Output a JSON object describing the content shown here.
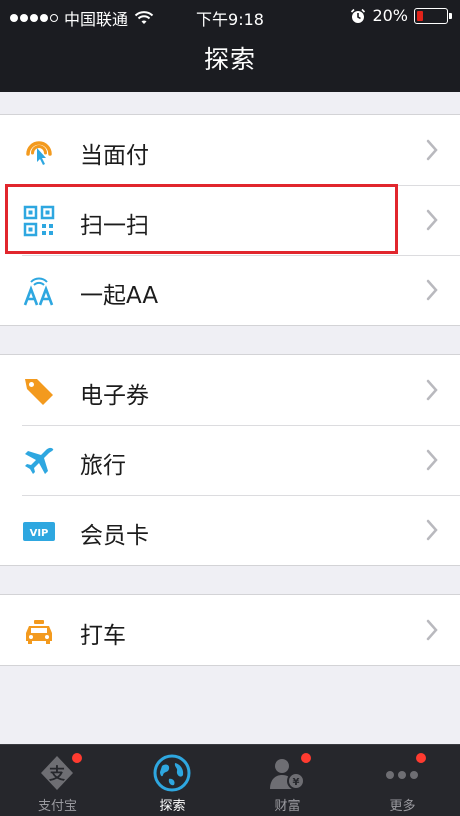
{
  "status_bar": {
    "carrier": "中国联通",
    "time": "下午9:18",
    "battery": "20%",
    "battery_level": 0.2
  },
  "nav": {
    "title": "探索"
  },
  "groups": [
    {
      "items": [
        {
          "label": "当面付",
          "icon": "face-to-face-pay-icon"
        },
        {
          "label": "扫一扫",
          "icon": "qr-scan-icon"
        },
        {
          "label": "一起AA",
          "icon": "split-bill-aa-icon"
        }
      ]
    },
    {
      "items": [
        {
          "label": "电子券",
          "icon": "coupon-tag-icon"
        },
        {
          "label": "旅行",
          "icon": "airplane-icon"
        },
        {
          "label": "会员卡",
          "icon": "vip-card-icon"
        }
      ]
    },
    {
      "items": [
        {
          "label": "打车",
          "icon": "taxi-icon"
        }
      ]
    }
  ],
  "tabs": [
    {
      "label": "支付宝",
      "icon": "alipay-icon",
      "badge": true
    },
    {
      "label": "探索",
      "icon": "explore-globe-icon",
      "active": true
    },
    {
      "label": "财富",
      "icon": "wealth-icon",
      "badge": true
    },
    {
      "label": "更多",
      "icon": "more-dots-icon",
      "badge": true
    }
  ],
  "colors": {
    "header_bg": "#1b1c21",
    "tabbar_bg": "#26272c",
    "highlight": "#e1262d",
    "accent_blue": "#2ea7e0",
    "accent_orange": "#f39a1e",
    "badge_red": "#ff3b30"
  }
}
